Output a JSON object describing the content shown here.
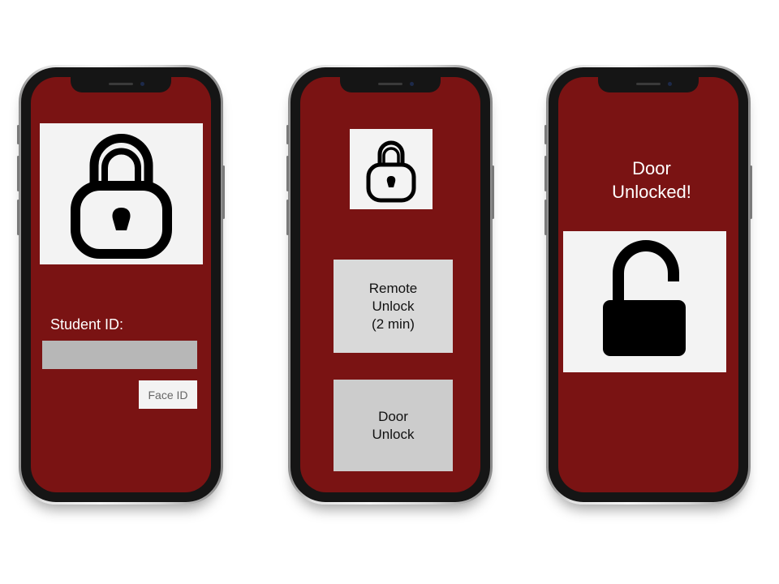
{
  "theme": {
    "screen_color": "#7a1313",
    "panel_color": "#f3f3f3",
    "input_color": "#b7b7b7",
    "button_color": "#d9d9d9"
  },
  "screens": {
    "login": {
      "icon": "padlock-locked-icon",
      "student_id_label": "Student ID:",
      "student_id_value": "",
      "face_id_label": "Face ID"
    },
    "controls": {
      "icon": "padlock-locked-icon",
      "remote_unlock_label": "Remote\nUnlock\n(2 min)",
      "door_unlock_label": "Door\nUnlock"
    },
    "unlocked": {
      "message": "Door\nUnlocked!",
      "icon": "padlock-open-icon"
    }
  }
}
